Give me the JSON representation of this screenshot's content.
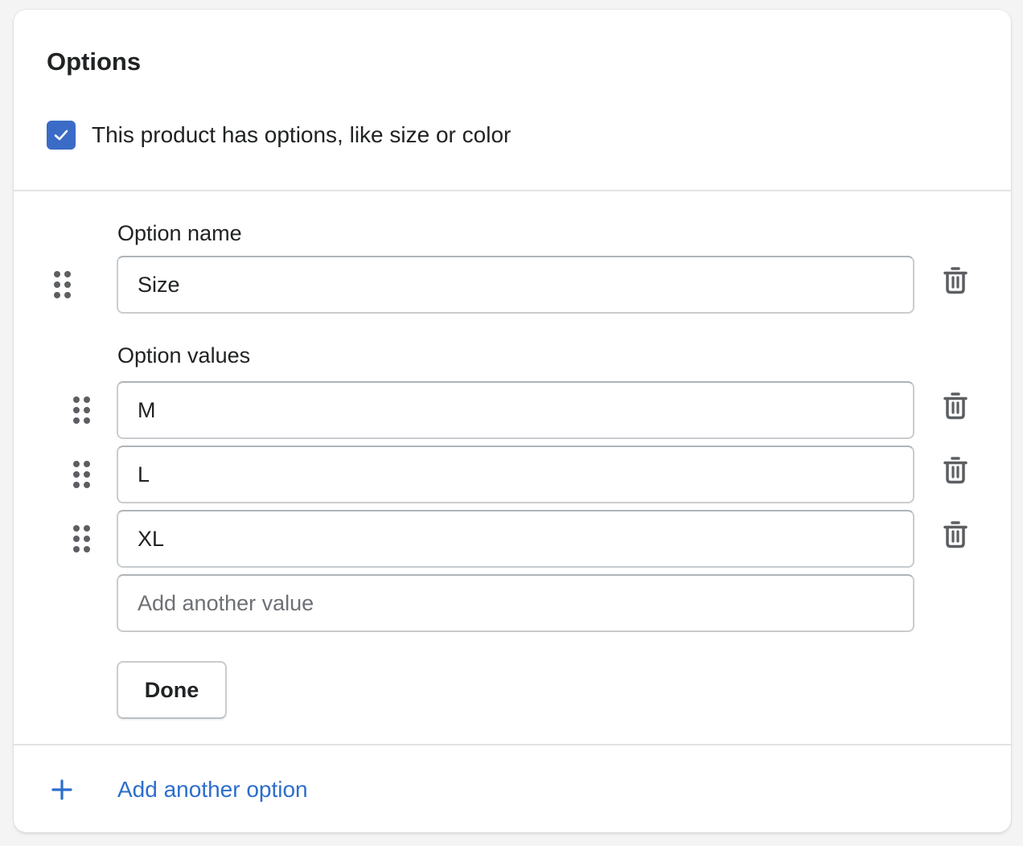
{
  "card": {
    "title": "Options",
    "has_options_checkbox": {
      "label": "This product has options, like size or color",
      "checked": true,
      "accent_color": "#3a6bc6",
      "icon": "checkmark-icon"
    }
  },
  "option": {
    "name_label": "Option name",
    "name_value": "Size",
    "values_label": "Option values",
    "values": [
      "M",
      "L",
      "XL"
    ],
    "new_value_placeholder": "Add another value",
    "done_label": "Done",
    "icons": {
      "drag": "drag-handle-icon",
      "delete": "trash-icon"
    }
  },
  "footer": {
    "add_option_label": "Add another option",
    "add_option_icon": "plus-icon",
    "link_color": "#2c6ecb"
  }
}
